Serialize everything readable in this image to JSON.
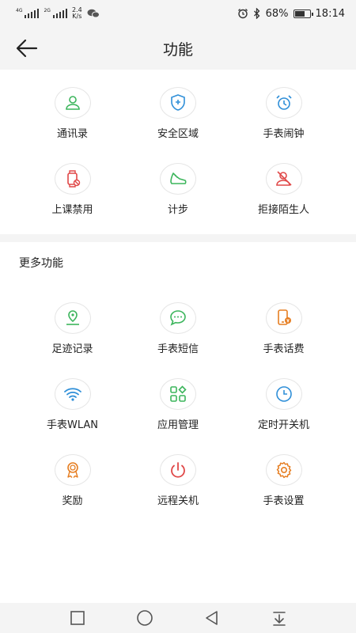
{
  "status": {
    "sig1_label": "4G",
    "sig2_label": "2G",
    "net_speed": "2.4",
    "net_unit": "K/s",
    "battery_pct": "68%",
    "battery_level": 0.68,
    "time": "18:14"
  },
  "header": {
    "title": "功能"
  },
  "primary_features": [
    {
      "label": "通讯录",
      "icon": "contacts-icon",
      "color": "#3cb55c"
    },
    {
      "label": "安全区域",
      "icon": "shield-pin-icon",
      "color": "#2f8fd8"
    },
    {
      "label": "手表闹钟",
      "icon": "alarm-clock-icon",
      "color": "#2f8fd8"
    },
    {
      "label": "上课禁用",
      "icon": "watch-block-icon",
      "color": "#e04848"
    },
    {
      "label": "计步",
      "icon": "shoe-icon",
      "color": "#3cb55c"
    },
    {
      "label": "拒接陌生人",
      "icon": "reject-stranger-icon",
      "color": "#e04848"
    }
  ],
  "more_section": {
    "title": "更多功能"
  },
  "more_features": [
    {
      "label": "足迹记录",
      "icon": "footprint-pin-icon",
      "color": "#3cb55c"
    },
    {
      "label": "手表短信",
      "icon": "chat-bubble-icon",
      "color": "#3cb55c"
    },
    {
      "label": "手表话费",
      "icon": "phone-bill-icon",
      "color": "#e67e22"
    },
    {
      "label": "手表WLAN",
      "icon": "wifi-icon",
      "color": "#2f8fd8"
    },
    {
      "label": "应用管理",
      "icon": "apps-grid-icon",
      "color": "#3cb55c"
    },
    {
      "label": "定时开关机",
      "icon": "clock-icon",
      "color": "#2f8fd8"
    },
    {
      "label": "奖励",
      "icon": "medal-icon",
      "color": "#e67e22"
    },
    {
      "label": "远程关机",
      "icon": "power-icon",
      "color": "#e04848"
    },
    {
      "label": "手表设置",
      "icon": "gear-icon",
      "color": "#e67e22"
    }
  ],
  "nav": {
    "icons": [
      "square-icon",
      "circle-icon",
      "back-triangle-icon",
      "notification-down-icon"
    ]
  }
}
